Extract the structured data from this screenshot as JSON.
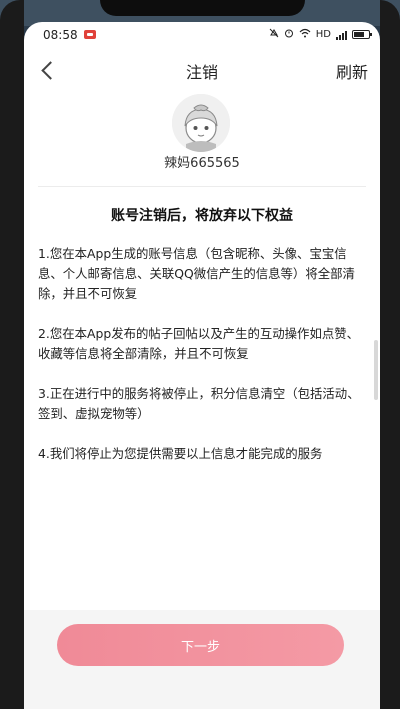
{
  "status_bar": {
    "time": "08:58",
    "network": "HD"
  },
  "nav": {
    "title": "注销",
    "refresh_label": "刷新"
  },
  "user": {
    "name": "辣妈665565"
  },
  "section_title": "账号注销后，将放弃以下权益",
  "terms": [
    "1.您在本App生成的账号信息（包含昵称、头像、宝宝信息、个人邮寄信息、关联QQ微信产生的信息等）将全部清除，并且不可恢复",
    "2.您在本App发布的帖子回帖以及产生的互动操作如点赞、收藏等信息将全部清除，并且不可恢复",
    "3.正在进行中的服务将被停止，积分信息清空（包括活动、签到、虚拟宠物等）",
    "4.我们将停止为您提供需要以上信息才能完成的服务"
  ],
  "next_button_label": "下一步",
  "colors": {
    "accent": "#f08a97",
    "notification": "#e0413a"
  }
}
